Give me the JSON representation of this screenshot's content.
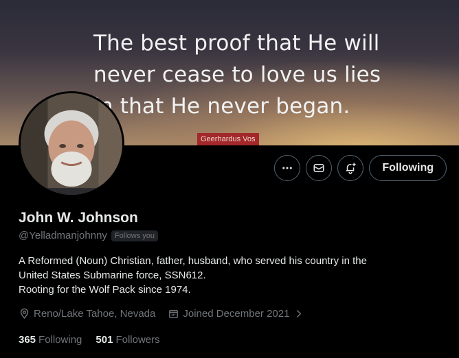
{
  "banner": {
    "quote_lines": [
      "The best proof that He will",
      "never cease to love us lies",
      "in that He never began."
    ],
    "attribution": "Geerhardus Vos"
  },
  "actions": {
    "more_icon": "more-icon",
    "message_icon": "envelope-icon",
    "notify_icon": "bell-plus-icon",
    "following_label": "Following"
  },
  "profile": {
    "name": "John W. Johnson",
    "handle": "@Yelladmanjohnny",
    "follows_you": "Follows you",
    "bio_lines": [
      "A Reformed (Noun) Christian, father, husband, who served his country in the",
      "United States Submarine force, SSN612.",
      "Rooting for the Wolf Pack since 1974."
    ],
    "location": "Reno/Lake Tahoe, Nevada",
    "joined": "Joined December 2021"
  },
  "stats": {
    "following_count": "365",
    "following_label": "Following",
    "followers_count": "501",
    "followers_label": "Followers"
  }
}
